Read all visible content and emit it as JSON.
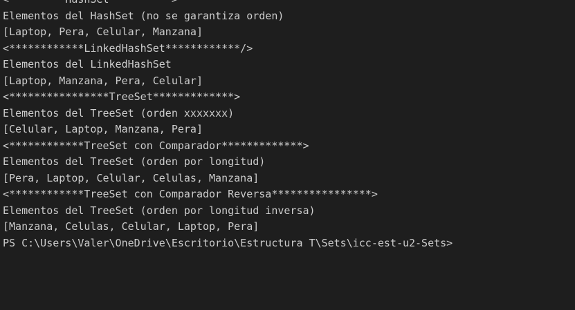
{
  "terminal": {
    "lines": [
      "<*********HashSet**********>",
      "Elementos del HashSet (no se garantiza orden)",
      "[Laptop, Pera, Celular, Manzana]",
      "<************LinkedHashSet************/>",
      "Elementos del LinkedHashSet",
      "[Laptop, Manzana, Pera, Celular]",
      "<****************TreeSet*************>",
      "Elementos del TreeSet (orden xxxxxxx)",
      "[Celular, Laptop, Manzana, Pera]",
      "<************TreeSet con Comparador*************>",
      "Elementos del TreeSet (orden por longitud)",
      "[Pera, Laptop, Celular, Celulas, Manzana]",
      "<************TreeSet con Comparador Reversa****************>",
      "Elementos del TreeSet (orden por longitud inversa)",
      "[Manzana, Celulas, Celular, Laptop, Pera]",
      "PS C:\\Users\\Valer\\OneDrive\\Escritorio\\Estructura T\\Sets\\icc-est-u2-Sets>"
    ]
  },
  "colors": {
    "background": "#1e1e1e",
    "text": "#cccccc"
  }
}
